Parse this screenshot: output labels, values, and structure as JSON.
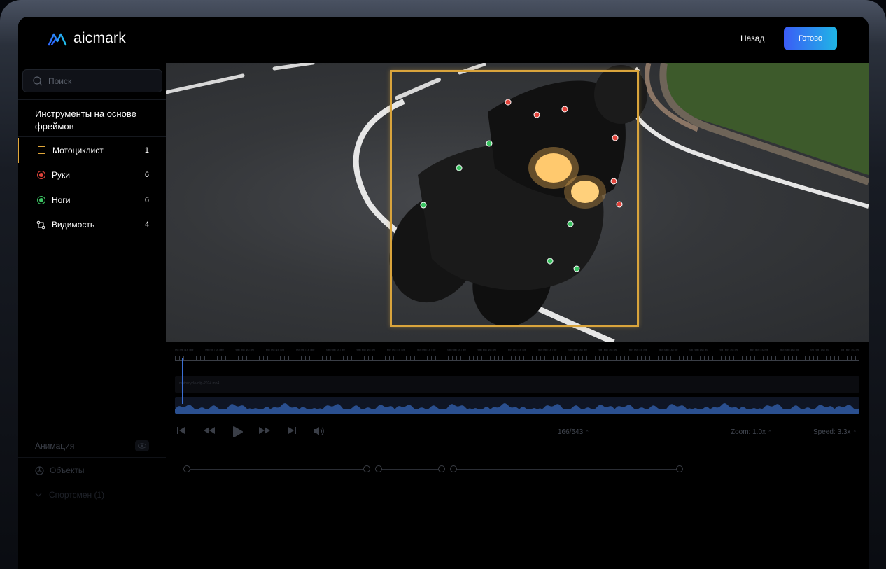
{
  "header": {
    "brand": "aicmark",
    "back_label": "Назад",
    "done_label": "Готово"
  },
  "sidebar": {
    "search_placeholder": "Поиск",
    "section_title": "Инструменты на основе фреймов",
    "tools": [
      {
        "name": "Мотоциклист",
        "count": "1",
        "icon": "bbox-square-icon"
      },
      {
        "name": "Руки",
        "count": "6",
        "icon": "red-point-icon"
      },
      {
        "name": "Ноги",
        "count": "6",
        "icon": "green-point-icon"
      },
      {
        "name": "Видимость",
        "count": "4",
        "icon": "visibility-icon"
      }
    ],
    "animation_label": "Анимация",
    "objects_label": "Объекты",
    "athlete_label": "Спортсмен (1)"
  },
  "timeline": {
    "ruler_label": "00:00:15:00",
    "track_label": "motorcycle-clip-2024.mp4",
    "frame_counter": "166/543",
    "zoom": "Zoom: 1.0x",
    "speed": "Speed: 3.3x"
  },
  "colors": {
    "accent_bbox": "#d9a43c",
    "hands": "#e2443b",
    "legs": "#3cc463",
    "button_gradient_start": "#3b5cf6",
    "button_gradient_end": "#1fb6e6"
  },
  "keypoints": {
    "hands": 6,
    "legs": 6
  }
}
